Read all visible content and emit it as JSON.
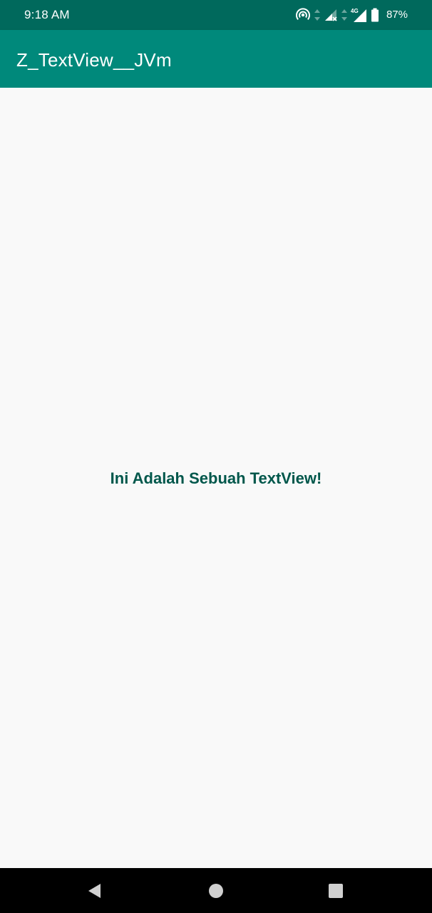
{
  "status_bar": {
    "time": "9:18 AM",
    "battery_percent": "87%",
    "network_label": "4G",
    "icons": [
      "hotspot-icon",
      "data-arrows-icon",
      "signal-no-data-icon",
      "signal-4g-icon",
      "battery-icon"
    ]
  },
  "app_bar": {
    "title": "Z_TextView__JVm"
  },
  "content": {
    "text": "Ini Adalah Sebuah TextView!"
  },
  "nav_bar": {
    "buttons": [
      "back-icon",
      "home-icon",
      "recents-icon"
    ]
  },
  "colors": {
    "status_bar": "#00695c",
    "app_bar": "#00897b",
    "text": "#00574b",
    "background": "#f9f9f9"
  }
}
